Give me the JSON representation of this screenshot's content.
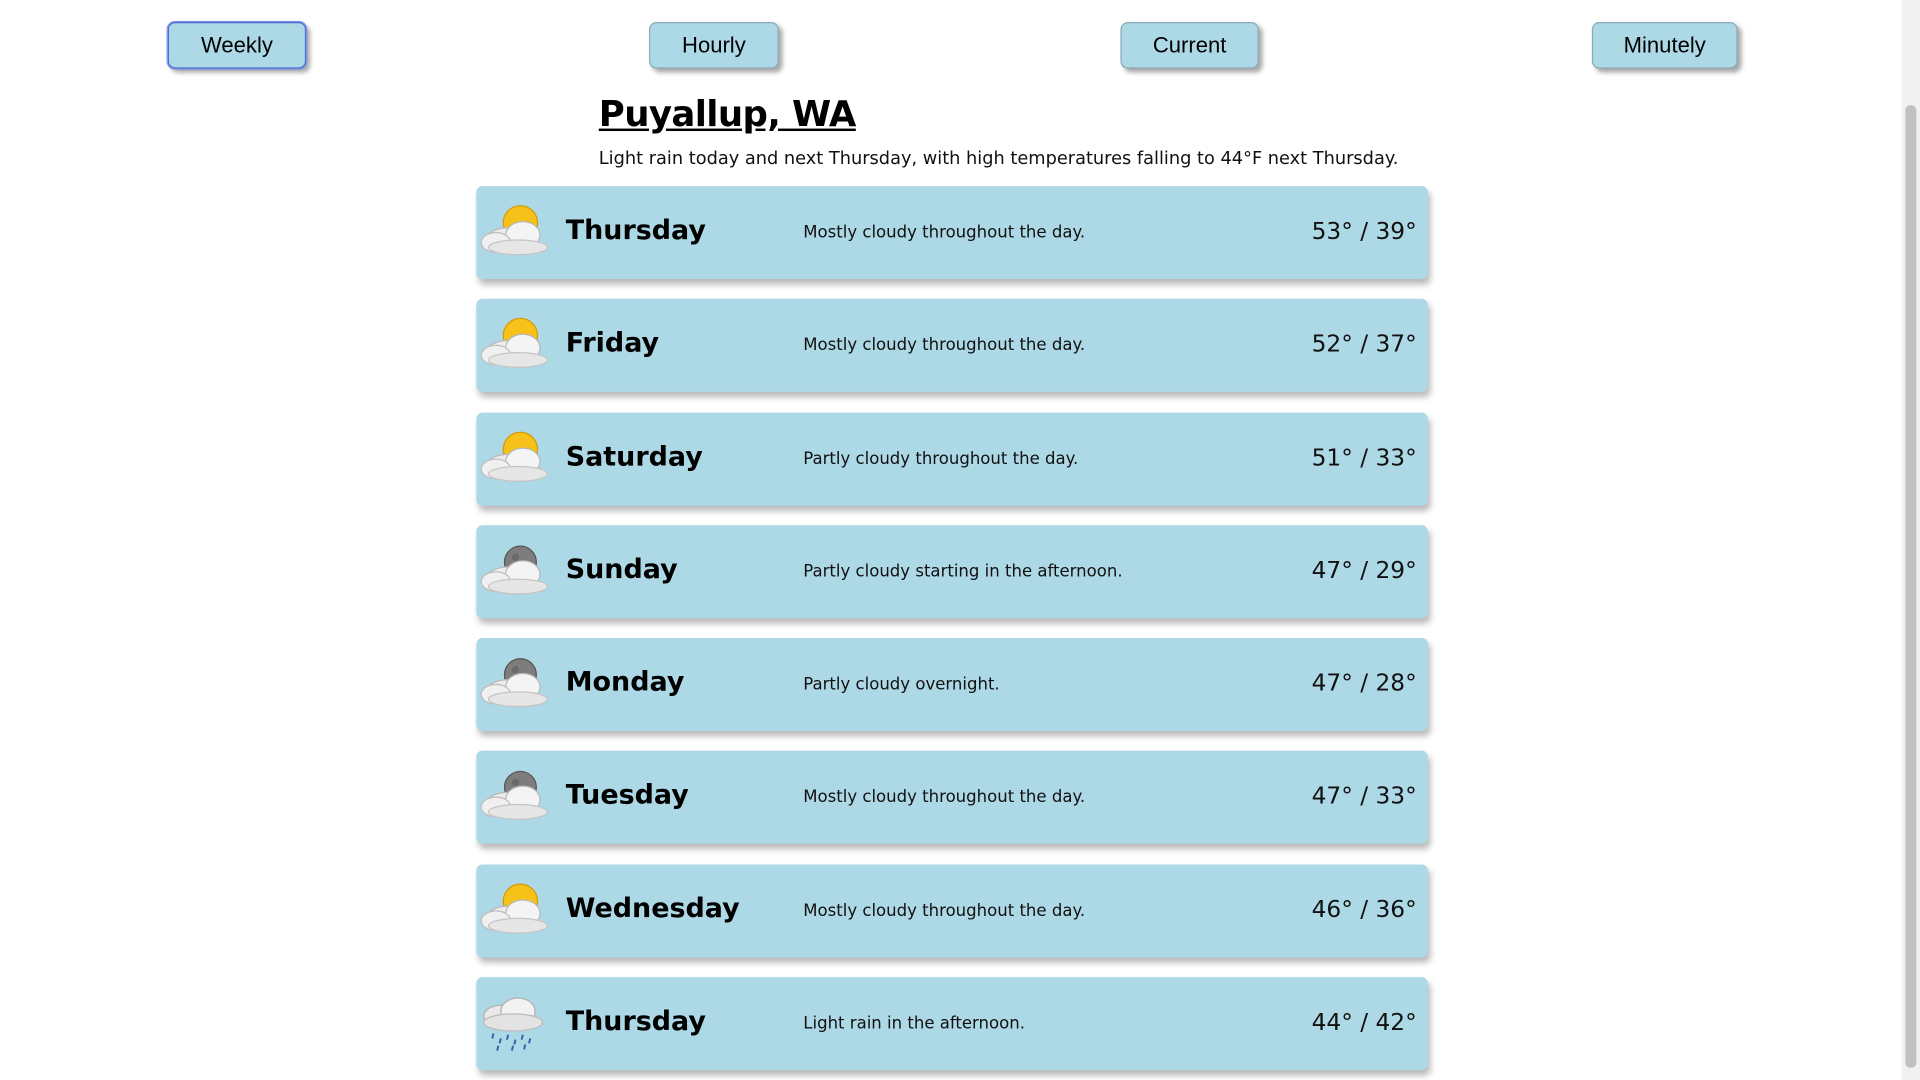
{
  "nav": {
    "weekly": "Weekly",
    "hourly": "Hourly",
    "current": "Current",
    "minutely": "Minutely",
    "active": "Weekly"
  },
  "location": "Puyallup, WA",
  "summary": "Light rain today and next Thursday, with high temperatures falling to 44°F next Thursday.",
  "days": [
    {
      "day": "Thursday",
      "desc": "Mostly cloudy throughout the day.",
      "temp": "53° / 39°",
      "icon": "partly-cloudy-day-icon"
    },
    {
      "day": "Friday",
      "desc": "Mostly cloudy throughout the day.",
      "temp": "52° / 37°",
      "icon": "partly-cloudy-day-icon"
    },
    {
      "day": "Saturday",
      "desc": "Partly cloudy throughout the day.",
      "temp": "51° / 33°",
      "icon": "partly-cloudy-day-icon"
    },
    {
      "day": "Sunday",
      "desc": "Partly cloudy starting in the afternoon.",
      "temp": "47° / 29°",
      "icon": "partly-cloudy-night-icon"
    },
    {
      "day": "Monday",
      "desc": "Partly cloudy overnight.",
      "temp": "47° / 28°",
      "icon": "partly-cloudy-night-icon"
    },
    {
      "day": "Tuesday",
      "desc": "Mostly cloudy throughout the day.",
      "temp": "47° / 33°",
      "icon": "partly-cloudy-night-icon"
    },
    {
      "day": "Wednesday",
      "desc": "Mostly cloudy throughout the day.",
      "temp": "46° / 36°",
      "icon": "partly-cloudy-day-icon"
    },
    {
      "day": "Thursday",
      "desc": "Light rain in the afternoon.",
      "temp": "44° / 42°",
      "icon": "rain-icon"
    }
  ],
  "colors": {
    "card": "#add8e6",
    "button": "#add8e6",
    "sun": "#f6c21a",
    "moon": "#7d7d7d",
    "rain": "#3a5fa8"
  }
}
